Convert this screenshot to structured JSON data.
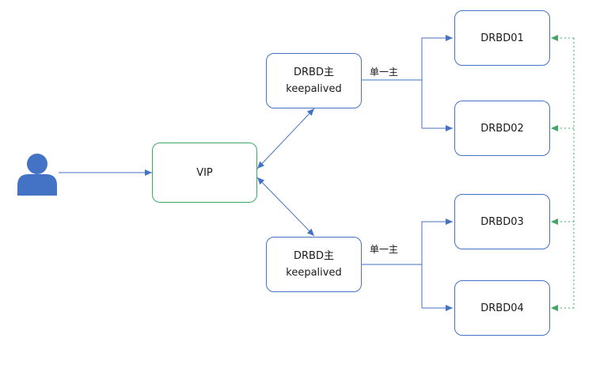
{
  "nodes": {
    "vip": "VIP",
    "master1": {
      "line1": "DRBD主",
      "line2": "keepalived"
    },
    "master2": {
      "line1": "DRBD主",
      "line2": "keepalived"
    },
    "drbd01": "DRBD01",
    "drbd02": "DRBD02",
    "drbd03": "DRBD03",
    "drbd04": "DRBD04"
  },
  "edge_labels": {
    "top": "单一主",
    "bottom": "单一主"
  },
  "icons": {
    "user": "user-icon"
  },
  "colors": {
    "arrow": "#4472c4",
    "vip_border": "#3ca862",
    "node_border": "#4472c4",
    "dotted": "#3ca862",
    "user": "#4472c4"
  }
}
